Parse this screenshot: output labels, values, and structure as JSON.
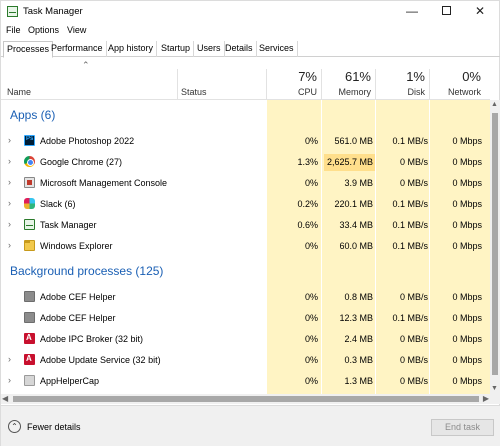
{
  "window": {
    "title": "Task Manager"
  },
  "menu": [
    "File",
    "Options",
    "View"
  ],
  "tabs": [
    "Processes",
    "Performance",
    "App history",
    "Startup",
    "Users",
    "Details",
    "Services"
  ],
  "active_tab": "Processes",
  "columns": {
    "name": "Name",
    "status": "Status",
    "cpu": {
      "pct": "7%",
      "label": "CPU"
    },
    "memory": {
      "pct": "61%",
      "label": "Memory"
    },
    "disk": {
      "pct": "1%",
      "label": "Disk"
    },
    "network": {
      "pct": "0%",
      "label": "Network"
    }
  },
  "groups": {
    "apps": "Apps (6)",
    "background": "Background processes (125)"
  },
  "apps": [
    {
      "name": "Adobe Photoshop 2022",
      "icon": "photoshop-icon",
      "cpu": "0%",
      "memory": "561.0 MB",
      "disk": "0.1 MB/s",
      "network": "0 Mbps"
    },
    {
      "name": "Google Chrome (27)",
      "icon": "chrome-icon",
      "cpu": "1.3%",
      "memory": "2,625.7 MB",
      "disk": "0 MB/s",
      "network": "0 Mbps"
    },
    {
      "name": "Microsoft Management Console",
      "icon": "mmc-icon",
      "cpu": "0%",
      "memory": "3.9 MB",
      "disk": "0 MB/s",
      "network": "0 Mbps"
    },
    {
      "name": "Slack (6)",
      "icon": "slack-icon",
      "cpu": "0.2%",
      "memory": "220.1 MB",
      "disk": "0.1 MB/s",
      "network": "0 Mbps"
    },
    {
      "name": "Task Manager",
      "icon": "task-manager-icon",
      "cpu": "0.6%",
      "memory": "33.4 MB",
      "disk": "0.1 MB/s",
      "network": "0 Mbps"
    },
    {
      "name": "Windows Explorer",
      "icon": "explorer-icon",
      "cpu": "0%",
      "memory": "60.0 MB",
      "disk": "0.1 MB/s",
      "network": "0 Mbps"
    }
  ],
  "background": [
    {
      "name": "Adobe CEF Helper",
      "icon": "adobe-cef-icon",
      "cpu": "0%",
      "memory": "0.8 MB",
      "disk": "0 MB/s",
      "network": "0 Mbps"
    },
    {
      "name": "Adobe CEF Helper",
      "icon": "adobe-cef-icon",
      "cpu": "0%",
      "memory": "12.3 MB",
      "disk": "0.1 MB/s",
      "network": "0 Mbps"
    },
    {
      "name": "Adobe IPC Broker (32 bit)",
      "icon": "adobe-ipc-icon",
      "cpu": "0%",
      "memory": "2.4 MB",
      "disk": "0 MB/s",
      "network": "0 Mbps"
    },
    {
      "name": "Adobe Update Service (32 bit)",
      "icon": "adobe-update-icon",
      "cpu": "0%",
      "memory": "0.3 MB",
      "disk": "0 MB/s",
      "network": "0 Mbps"
    },
    {
      "name": "AppHelperCap",
      "icon": "app-icon",
      "cpu": "0%",
      "memory": "1.3 MB",
      "disk": "0 MB/s",
      "network": "0 Mbps"
    }
  ],
  "footer": {
    "fewer_details": "Fewer details",
    "end_task": "End task"
  },
  "colors": {
    "group_title": "#1a5fb4",
    "column_shade": "#fff4c4",
    "memory_highlight": "#ffdf8c"
  }
}
